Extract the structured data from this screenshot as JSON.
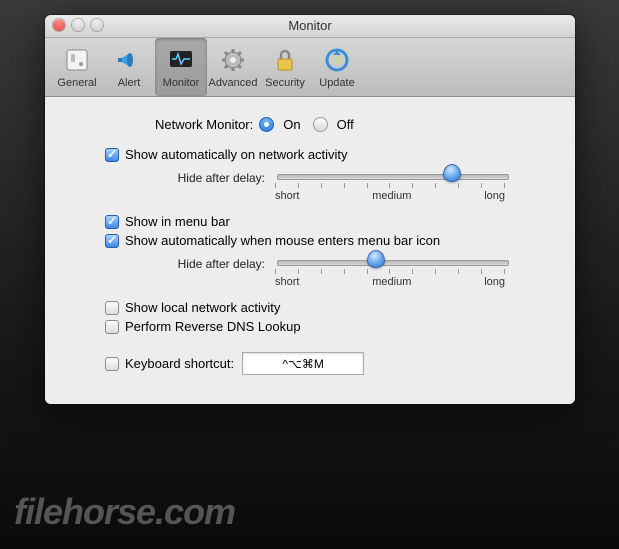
{
  "window": {
    "title": "Monitor"
  },
  "toolbar": {
    "items": [
      {
        "label": "General"
      },
      {
        "label": "Alert"
      },
      {
        "label": "Monitor"
      },
      {
        "label": "Advanced"
      },
      {
        "label": "Security"
      },
      {
        "label": "Update"
      }
    ]
  },
  "main": {
    "network_monitor_label": "Network Monitor:",
    "on_label": "On",
    "off_label": "Off",
    "network_monitor_value": "on",
    "show_auto_activity": {
      "label": "Show automatically on network activity",
      "checked": true
    },
    "hide_after_delay_label": "Hide after delay:",
    "slider_ticks": {
      "short": "short",
      "medium": "medium",
      "long": "long"
    },
    "slider1_value": 78,
    "show_in_menu_bar": {
      "label": "Show in menu bar",
      "checked": true
    },
    "show_auto_mouse": {
      "label": "Show automatically when mouse enters menu bar icon",
      "checked": true
    },
    "slider2_value": 42,
    "show_local": {
      "label": "Show local network activity",
      "checked": false
    },
    "reverse_dns": {
      "label": "Perform Reverse DNS Lookup",
      "checked": false
    },
    "keyboard_shortcut": {
      "label": "Keyboard shortcut:",
      "checked": false,
      "value": "^⌥⌘M"
    }
  },
  "watermark": "filehorse.com"
}
